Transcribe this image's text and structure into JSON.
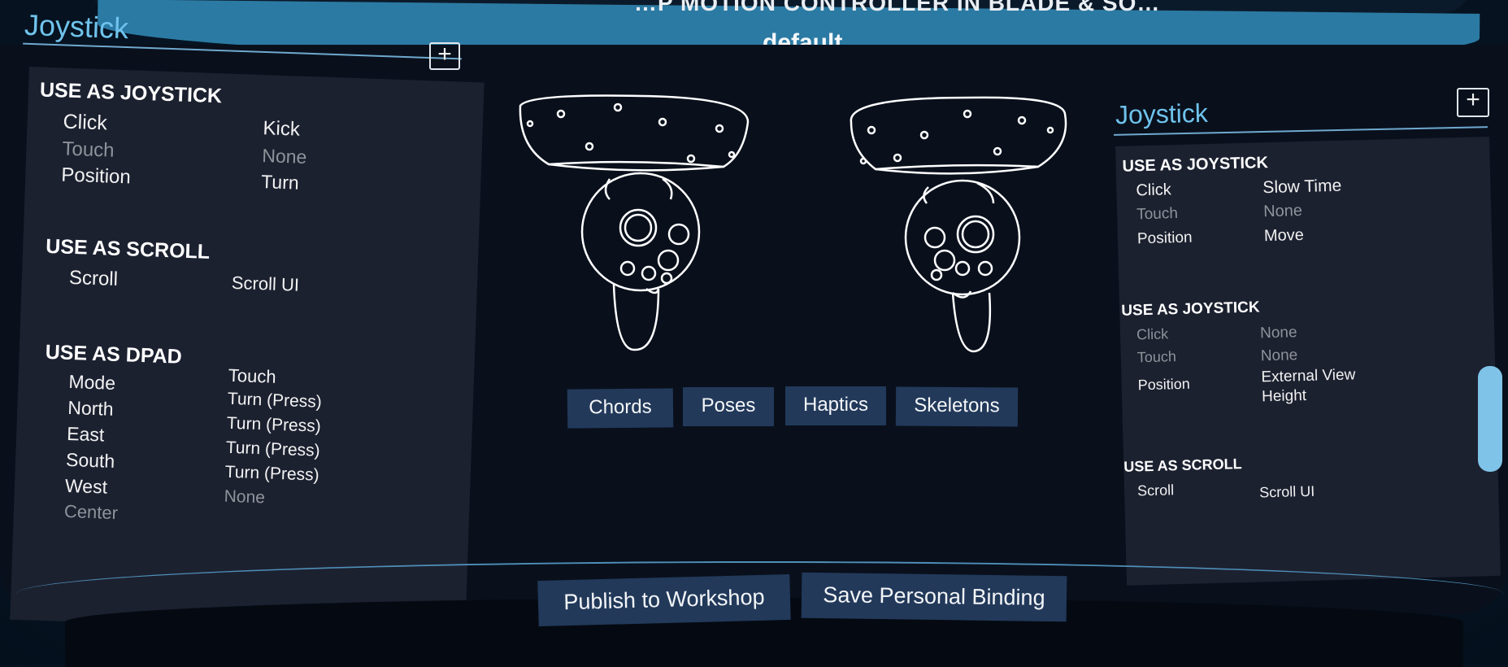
{
  "app": {
    "title": "…P MOTION CONTROLLER IN BLADE & SO…",
    "binding_name": "default"
  },
  "left_panel": {
    "heading": "Joystick",
    "add_label": "+",
    "sections": [
      {
        "title": "USE AS JOYSTICK",
        "rows": [
          {
            "input": "Click",
            "action": "Kick",
            "dim": false
          },
          {
            "input": "Touch",
            "action": "None",
            "dim": true
          },
          {
            "input": "Position",
            "action": "Turn",
            "dim": false
          }
        ]
      },
      {
        "title": "USE AS SCROLL",
        "rows": [
          {
            "input": "Scroll",
            "action": "Scroll UI",
            "dim": false
          }
        ]
      },
      {
        "title": "USE AS DPAD",
        "rows": [
          {
            "input": "Mode",
            "action": "Touch",
            "dim": false
          },
          {
            "input": "North",
            "action": "Turn (Press)",
            "dim": false
          },
          {
            "input": "East",
            "action": "Turn (Press)",
            "dim": false
          },
          {
            "input": "South",
            "action": "Turn (Press)",
            "dim": false
          },
          {
            "input": "West",
            "action": "Turn (Press)",
            "dim": false
          },
          {
            "input": "Center",
            "action": "None",
            "dim": true
          }
        ]
      }
    ]
  },
  "right_panel": {
    "heading": "Joystick",
    "add_label": "+",
    "sections": [
      {
        "title": "USE AS JOYSTICK",
        "rows": [
          {
            "input": "Click",
            "action": "Slow Time",
            "dim": false
          },
          {
            "input": "Touch",
            "action": "None",
            "dim": true
          },
          {
            "input": "Position",
            "action": "Move",
            "dim": false
          }
        ]
      },
      {
        "title": "USE AS JOYSTICK",
        "rows": [
          {
            "input": "Click",
            "action": "None",
            "dim": true
          },
          {
            "input": "Touch",
            "action": "None",
            "dim": true
          },
          {
            "input": "Position",
            "action": "External View",
            "action2": "Height",
            "dim": false
          }
        ]
      },
      {
        "title": "USE AS SCROLL",
        "rows": [
          {
            "input": "Scroll",
            "action": "Scroll UI",
            "dim": false
          }
        ]
      }
    ]
  },
  "tabs": [
    "Chords",
    "Poses",
    "Haptics",
    "Skeletons"
  ],
  "footer": {
    "publish_label": "Publish to Workshop",
    "save_label": "Save Personal Binding"
  },
  "colors": {
    "accent_blue": "#2b7aa3",
    "heading_blue": "#6fc3ec",
    "button_bg": "#22395a",
    "card_bg": "#1c2130"
  },
  "icons": {
    "left_controller": "left-vr-controller-icon",
    "right_controller": "right-vr-controller-icon",
    "add": "plus-square-icon"
  }
}
